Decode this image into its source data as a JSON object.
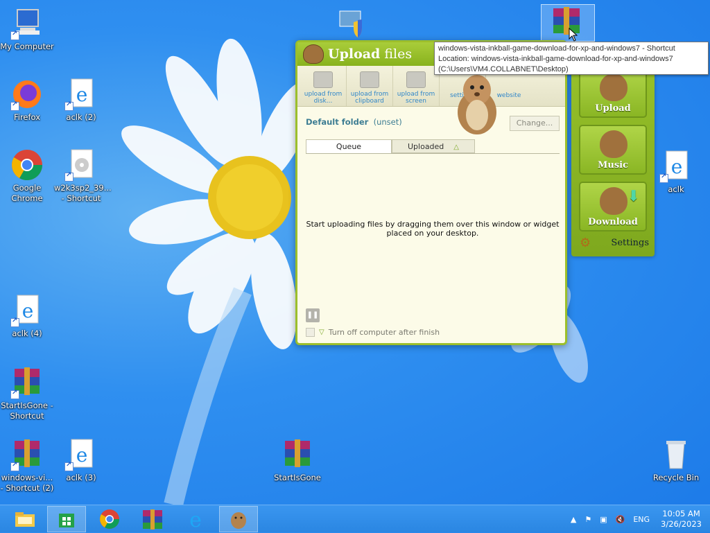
{
  "desktop": {
    "icons": [
      {
        "id": "my-computer",
        "label": "My Computer"
      },
      {
        "id": "firefox",
        "label": "Firefox"
      },
      {
        "id": "aclk-2",
        "label": "aclk (2)"
      },
      {
        "id": "chrome",
        "label": "Google Chrome"
      },
      {
        "id": "w2k3",
        "label": "w2k3sp2_39... - Shortcut"
      },
      {
        "id": "aclk-4",
        "label": "aclk (4)"
      },
      {
        "id": "startisgone-shortcut",
        "label": "StartIsGone - Shortcut"
      },
      {
        "id": "windows-vi",
        "label": "windows-vi... - Shortcut (2)"
      },
      {
        "id": "aclk-3",
        "label": "aclk (3)"
      },
      {
        "id": "startisgone",
        "label": "StartIsGone"
      },
      {
        "id": "aclk",
        "label": "aclk"
      },
      {
        "id": "recycle-bin",
        "label": "Recycle Bin"
      }
    ]
  },
  "tooltip": {
    "line1": "windows-vista-inkball-game-download-for-xp-and-windows7 - Shortcut",
    "line2": "Location: windows-vista-inkball-game-download-for-xp-and-windows7",
    "line3": "(C:\\Users\\VM4.COLLABNET\\Desktop)"
  },
  "upload_window": {
    "title_bold": "Upload",
    "title_rest": "files",
    "tools": [
      {
        "label": "upload from disk..."
      },
      {
        "label": "upload from clipboard"
      },
      {
        "label": "upload from screen"
      },
      {
        "label": "settings"
      },
      {
        "label": "website"
      }
    ],
    "default_folder_label": "Default folder",
    "default_folder_value": "(unset)",
    "change_button": "Change...",
    "tab_queue": "Queue",
    "tab_uploaded": "Uploaded",
    "empty_message": "Start uploading files by dragging them over this window or widget placed on your desktop.",
    "turn_off_label": "Turn off computer after finish"
  },
  "widget": {
    "upload": "Upload",
    "music": "Music",
    "download": "Download",
    "settings": "Settings"
  },
  "taskbar": {
    "language": "ENG",
    "time": "10:05 AM",
    "date": "3/26/2023"
  },
  "colors": {
    "accent_green": "#9cbf2b",
    "desktop_blue": "#2f8ff0"
  }
}
